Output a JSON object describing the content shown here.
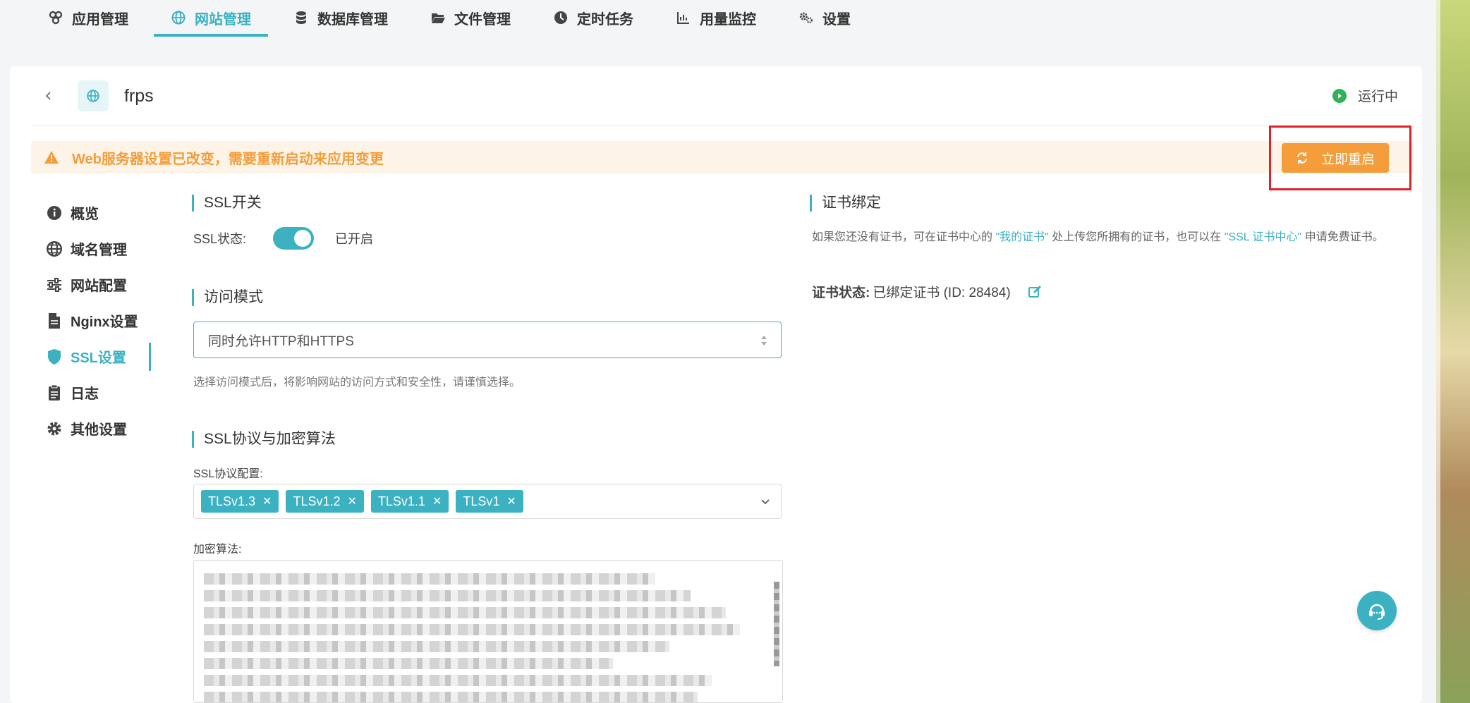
{
  "nav": {
    "items": [
      {
        "label": "应用管理",
        "icon": "apps-icon"
      },
      {
        "label": "网站管理",
        "icon": "globe-icon",
        "active": true
      },
      {
        "label": "数据库管理",
        "icon": "database-icon"
      },
      {
        "label": "文件管理",
        "icon": "folder-icon"
      },
      {
        "label": "定时任务",
        "icon": "clock-icon"
      },
      {
        "label": "用量监控",
        "icon": "chart-icon"
      },
      {
        "label": "设置",
        "icon": "gears-icon"
      }
    ]
  },
  "site": {
    "name": "frps",
    "status": "运行中"
  },
  "warning": {
    "text": "Web服务器设置已改变，需要重新启动来应用变更",
    "button": "立即重启"
  },
  "side": {
    "items": [
      {
        "label": "概览",
        "icon": "info-icon"
      },
      {
        "label": "域名管理",
        "icon": "globe-icon"
      },
      {
        "label": "网站配置",
        "icon": "sliders-icon"
      },
      {
        "label": "Nginx设置",
        "icon": "file-icon"
      },
      {
        "label": "SSL设置",
        "icon": "shield-icon",
        "active": true
      },
      {
        "label": "日志",
        "icon": "clipboard-icon"
      },
      {
        "label": "其他设置",
        "icon": "gear-icon"
      }
    ]
  },
  "ssl": {
    "switch_title": "SSL开关",
    "status_label": "SSL状态:",
    "status_value": "已开启",
    "mode_title": "访问模式",
    "mode_value": "同时允许HTTP和HTTPS",
    "mode_hint": "选择访问模式后，将影响网站的访问方式和安全性，请谨慎选择。",
    "protocol_title": "SSL协议与加密算法",
    "protocol_label": "SSL协议配置:",
    "protocols": [
      "TLSv1.3",
      "TLSv1.2",
      "TLSv1.1",
      "TLSv1"
    ],
    "cipher_label": "加密算法:"
  },
  "cert": {
    "title": "证书绑定",
    "desc_1": "如果您还没有证书，可在证书中心的",
    "link_1": "\"我的证书\"",
    "desc_2": "处上传您所拥有的证书，也可以在",
    "link_2": "\"SSL 证书中心\"",
    "desc_3": "申请免费证书。",
    "status_label": "证书状态:",
    "status_value": "已绑定证书 (ID: 28484)"
  },
  "colors": {
    "accent": "#3bb1c2",
    "warning": "#f49d3a",
    "running": "#2fb35a",
    "highlight": "#e0202a"
  }
}
